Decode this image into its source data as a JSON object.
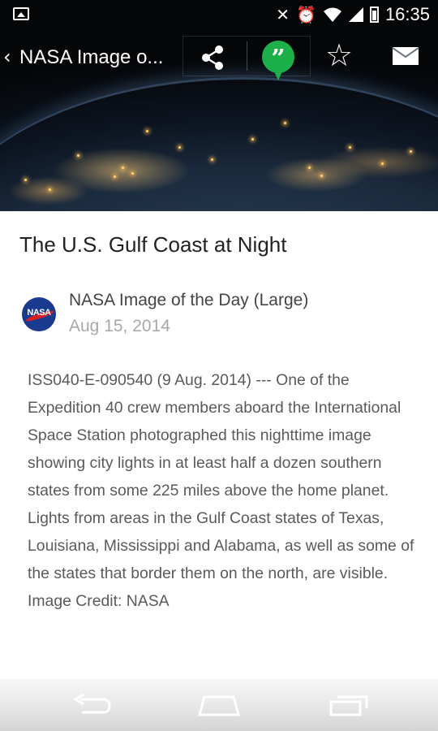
{
  "status_bar": {
    "time": "16:35",
    "icons": [
      "picture-icon",
      "mute-icon",
      "alarm-icon",
      "wifi-icon",
      "signal-icon",
      "battery-icon"
    ]
  },
  "action_bar": {
    "back_glyph": "‹",
    "title": "NASA Image o...",
    "actions": [
      "share-icon",
      "hangouts-icon",
      "star-icon",
      "mail-icon"
    ],
    "hangouts_glyph": "”"
  },
  "article": {
    "headline": "The U.S. Gulf Coast at Night",
    "source_name": "NASA Image of the Day (Large)",
    "date": "Aug 15, 2014",
    "avatar_text": "NASA",
    "body": "ISS040-E-090540 (9 Aug. 2014) --- One of the Expedition 40 crew members aboard the International Space Station photographed this nighttime image showing city lights in at least half a dozen southern states from some 225 miles above the home planet. Lights from areas in the Gulf Coast states of Texas, Louisiana, Mississippi and Alabama, as well as some of the states that border them on the north, are visible. Image Credit: NASA"
  },
  "nav_bar": {
    "buttons": [
      "back-icon",
      "home-icon",
      "recents-icon"
    ]
  },
  "colors": {
    "hangouts_green": "#1db04a",
    "headline_text": "#222222",
    "body_text": "#5a5a5a",
    "date_text": "#a8a8a8"
  }
}
